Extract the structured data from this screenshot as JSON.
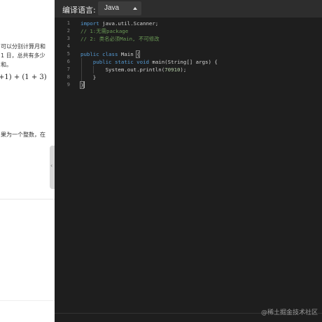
{
  "problem": {
    "lines": [
      "可以分别计算月和",
      "1 日，总共有多少",
      "和。"
    ],
    "math": "+1) + (1 + 3)",
    "line2": "果为一个整数，在"
  },
  "toolbar": {
    "language_label": "编译语言:",
    "language_value": "Java"
  },
  "editor": {
    "line_numbers": [
      "1",
      "2",
      "3",
      "4",
      "5",
      "6",
      "7",
      "8",
      "9"
    ],
    "code_lines": [
      [
        {
          "t": "import",
          "c": "kw"
        },
        {
          "t": " java.util.Scanner;",
          "c": ""
        }
      ],
      [
        {
          "t": "// 1:无需package",
          "c": "cm"
        }
      ],
      [
        {
          "t": "// 2: 类名必须Main, 不可修改",
          "c": "cm"
        }
      ],
      [],
      [
        {
          "t": "public",
          "c": "kw"
        },
        {
          "t": " ",
          "c": ""
        },
        {
          "t": "class",
          "c": "kw"
        },
        {
          "t": " Main {",
          "c": ""
        }
      ],
      [
        {
          "t": "    ",
          "c": ""
        },
        {
          "t": "public",
          "c": "kw"
        },
        {
          "t": " ",
          "c": ""
        },
        {
          "t": "static",
          "c": "kw"
        },
        {
          "t": " ",
          "c": ""
        },
        {
          "t": "void",
          "c": "kw"
        },
        {
          "t": " main(String[] args) {",
          "c": ""
        }
      ],
      [
        {
          "t": "        System.out.println(",
          "c": ""
        },
        {
          "t": "70910",
          "c": "nm"
        },
        {
          "t": ");",
          "c": ""
        }
      ],
      [
        {
          "t": "    }",
          "c": ""
        }
      ],
      [
        {
          "t": "}",
          "c": ""
        }
      ]
    ]
  },
  "watermark": "@稀土掘金技术社区",
  "handle_icon": "chevron-left-icon"
}
